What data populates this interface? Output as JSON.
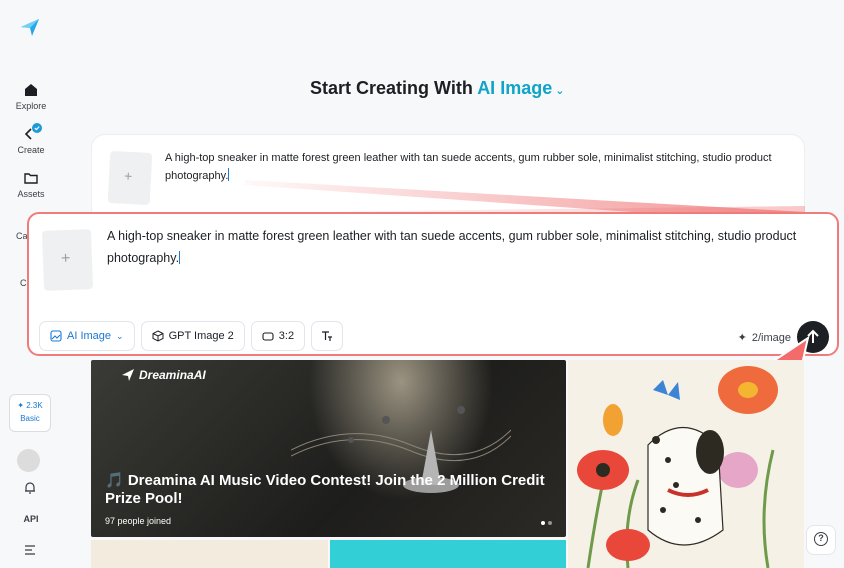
{
  "sidebar": {
    "items": [
      {
        "label": "Explore"
      },
      {
        "label": "Create"
      },
      {
        "label": "Assets"
      },
      {
        "label": "Ca"
      },
      {
        "label": "C"
      }
    ],
    "credits": {
      "amount": "2.3K",
      "plan": "Basic"
    },
    "api_label": "API"
  },
  "header": {
    "prefix": "Start Creating With",
    "mode": "AI Image"
  },
  "prompt": {
    "text": "A high-top sneaker in matte forest green leather with tan suede accents, gum rubber sole, minimalist stitching, studio product photography."
  },
  "toolbar": {
    "mode_label": "AI Image",
    "model_label": "GPT Image 2",
    "ratio_label": "3:2",
    "cost_label": "2/image"
  },
  "banner": {
    "brand": "DreaminaAI",
    "title": "🎵 Dreamina AI Music Video Contest! Join the 2 Million Credit Prize Pool!",
    "joined": "97 people joined"
  },
  "colors": {
    "accent": "#0fa4c8",
    "link_blue": "#1b78d0",
    "highlight_red": "#f07b7b"
  }
}
